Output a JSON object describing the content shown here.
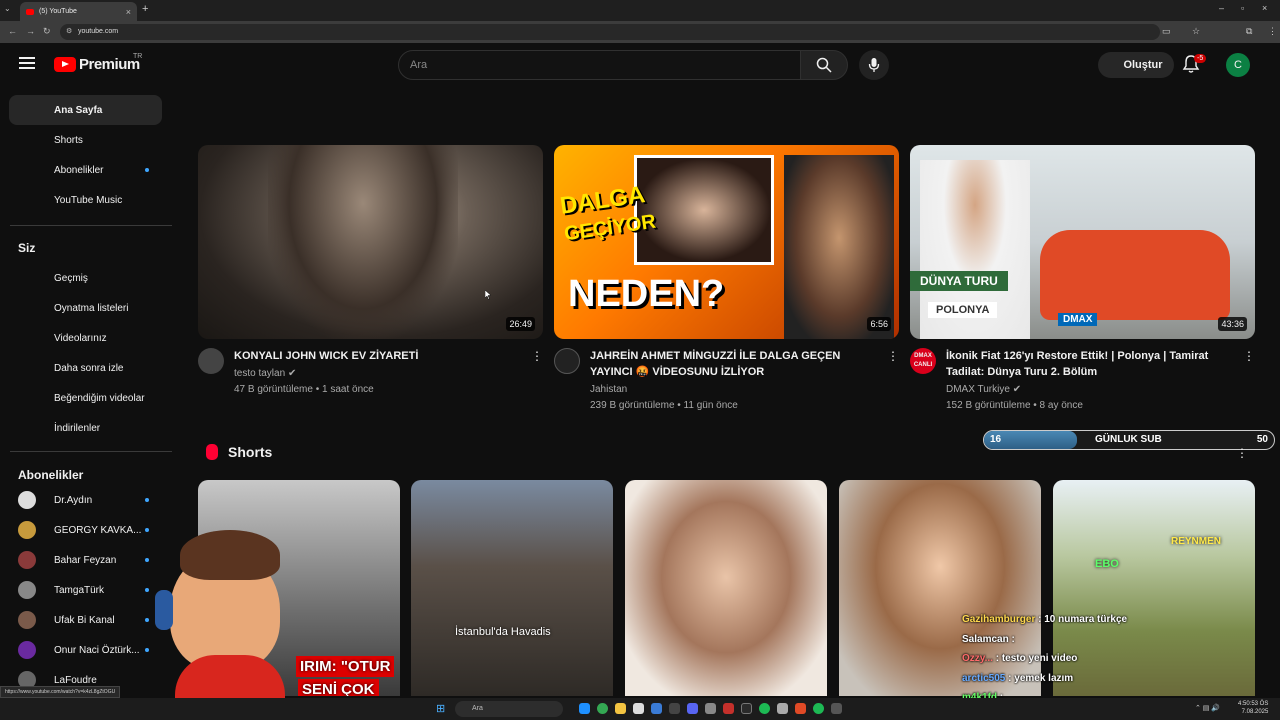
{
  "browser": {
    "tab_title": "(5) YouTube",
    "url": "youtube.com",
    "status_url": "https://www.youtube.com/watch?v=k4zL8gZtOGU"
  },
  "header": {
    "logo_text": "Premium",
    "region": "TR",
    "search_placeholder": "Ara",
    "create_label": "Oluştur",
    "notification_count": "5",
    "avatar_letter": "C"
  },
  "sidebar": {
    "main": [
      "Ana Sayfa",
      "Shorts",
      "Abonelikler",
      "YouTube Music"
    ],
    "you_heading": "Siz",
    "you_items": [
      "Geçmiş",
      "Oynatma listeleri",
      "Videolarınız",
      "Daha sonra izle",
      "Beğendiğim videolar",
      "İndirilenler"
    ],
    "subs_heading": "Abonelikler",
    "subs": [
      "Dr.Aydın",
      "GEORGY KAVKA...",
      "Bahar Feyzan",
      "TamgaTürk",
      "Ufak Bi Kanal",
      "Onur Naci Öztürk...",
      "LaFoudre"
    ]
  },
  "videos": [
    {
      "title": "KONYALI JOHN WICK EV ZİYARETİ",
      "channel": "testo taylan",
      "meta": "47 B görüntüleme • 1 saat önce",
      "duration": "26:49"
    },
    {
      "title": "JAHREİN AHMET MİNGUZZİ İLE DALGA GEÇEN YAYINCI 🤬 VİDEOSUNU İZLİYOR",
      "channel": "Jahistan",
      "meta": "239 B görüntüleme • 11 gün önce",
      "duration": "6:56",
      "thumb_texts": [
        "DALGA",
        "GEÇİYOR",
        "NEDEN?"
      ]
    },
    {
      "title": "İkonik Fiat 126'yı Restore Ettik! | Polonya | Tamirat Tadilat: Dünya Turu 2. Bölüm",
      "channel": "DMAX Turkiye",
      "meta": "152 B görüntüleme • 8 ay önce",
      "duration": "43:36",
      "thumb_texts": [
        "DÜNYA TURU",
        "POLONYA",
        "DMAX"
      ],
      "channel_avatar_texts": [
        "DMAX",
        "CANLI"
      ]
    }
  ],
  "shorts": {
    "heading": "Shorts",
    "captions": [
      "IRIM: \"OTUR",
      "SENİ ÇOK",
      "İstanbul'da Havadis",
      "EBO",
      "REYNMEN"
    ]
  },
  "overlay": {
    "sub_goal": {
      "current": "16",
      "label": "GÜNLUK SUB",
      "target": "50",
      "progress": 0.32
    },
    "chat": [
      {
        "user": "Gazihamburger",
        "text": ": 10 numara türkçe"
      },
      {
        "user": "Salamcan",
        "text": ":"
      },
      {
        "user": "Ozzy...",
        "text": ": testo yeni video"
      },
      {
        "user": "arctic505",
        "text": ": yemek lazım"
      },
      {
        "user": "m4k1fd",
        "text": ":"
      }
    ]
  },
  "taskbar": {
    "search": "Ara",
    "time": "4:50:53 ÖS",
    "date": "7.08.2025"
  }
}
